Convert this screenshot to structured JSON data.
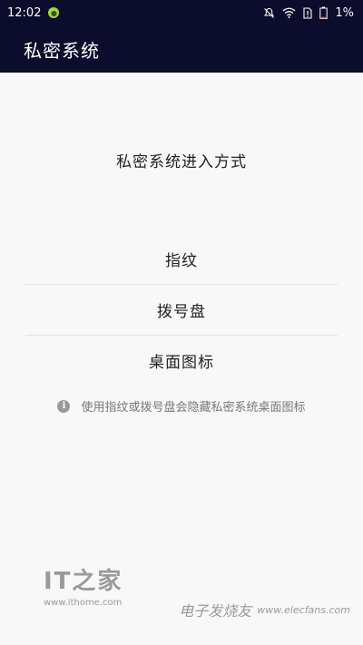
{
  "status_bar": {
    "time": "12:02",
    "battery_percent": "1%",
    "icons": [
      "notification-app-icon",
      "mute-icon",
      "wifi-icon",
      "sim-icon",
      "battery-icon"
    ]
  },
  "app_bar": {
    "title": "私密系统"
  },
  "main": {
    "section_title": "私密系统进入方式",
    "options": [
      {
        "label": "指纹"
      },
      {
        "label": "拨号盘"
      },
      {
        "label": "桌面图标"
      }
    ],
    "hint": "使用指纹或拨号盘会隐藏私密系统桌面图标"
  },
  "watermarks": {
    "left_logo": "IT之家",
    "left_url": "www.ithome.com",
    "right_cn": "电子发烧友",
    "right_en": "www.elecfans.com"
  },
  "colors": {
    "bar_background": "#0c0c2c",
    "page_background": "#f8f8f8",
    "divider": "#e4e4e4"
  }
}
